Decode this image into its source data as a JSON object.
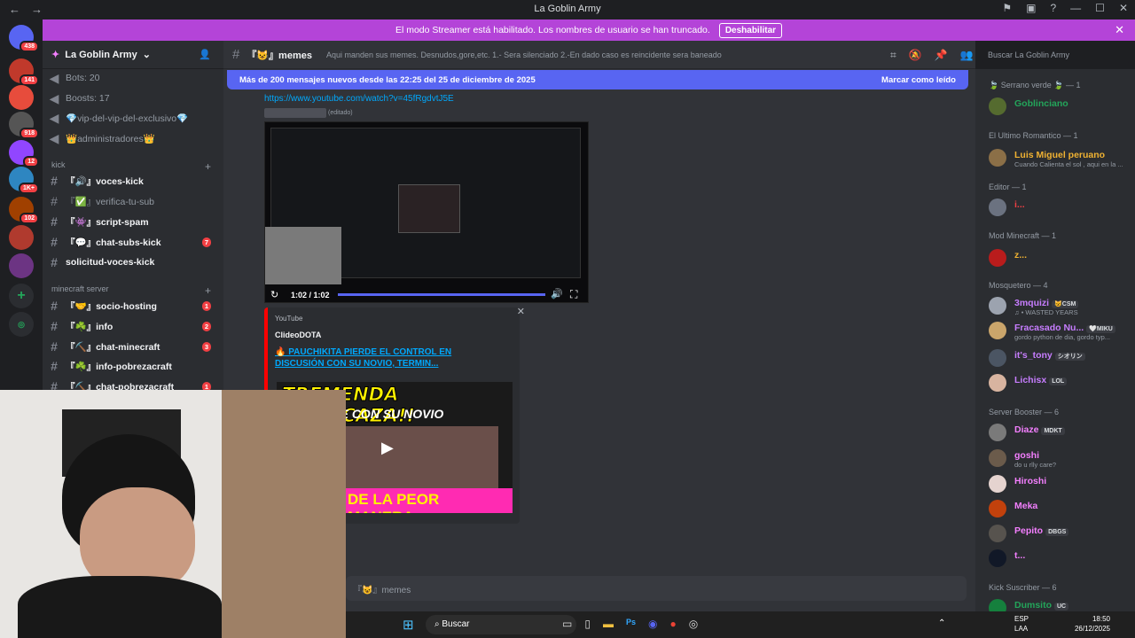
{
  "window": {
    "title": "La Goblin Army"
  },
  "banner": {
    "text": "El modo Streamer está habilitado. Los nombres de usuario se han truncado.",
    "button": "Deshabilitar"
  },
  "servers": [
    {
      "badge": "438"
    },
    {
      "badge": "141"
    },
    {
      "badge": ""
    },
    {
      "badge": "918"
    },
    {
      "badge": "12"
    },
    {
      "badge": "1K+"
    },
    {
      "badge": "102"
    },
    {
      "badge": ""
    },
    {
      "badge": ""
    }
  ],
  "server": {
    "name": "La Goblin Army"
  },
  "channels": {
    "top": [
      {
        "label": "Bots: 20"
      },
      {
        "label": "Boosts: 17"
      },
      {
        "label": "💎vip-del-vip-del-exclusivo💎"
      },
      {
        "label": "👑administradores👑"
      }
    ],
    "cat_kick": "kick",
    "kick": [
      {
        "label": "『🔊』voces-kick",
        "badge": ""
      },
      {
        "label": "『✅』verifica-tu-sub",
        "badge": ""
      },
      {
        "label": "『👾』script-spam",
        "badge": ""
      },
      {
        "label": "『💬』chat-subs-kick",
        "badge": "7"
      },
      {
        "label": "solicitud-voces-kick",
        "badge": ""
      }
    ],
    "cat_mc": "minecraft server",
    "mc": [
      {
        "label": "『🤝』socio-hosting",
        "badge": "1"
      },
      {
        "label": "『☘️』info",
        "badge": "2"
      },
      {
        "label": "『⛏️』chat-minecraft",
        "badge": "3"
      },
      {
        "label": "『☘️』info-pobrezacraft",
        "badge": ""
      },
      {
        "label": "『⛏️』chat-pobrezacraft",
        "badge": "1"
      }
    ]
  },
  "chat": {
    "channel": "『😺』memes",
    "topic": "Aqui manden sus memes. Desnudos,gore,etc. 1.- Sera silenciado 2.-En dado caso es reincidente sera baneado",
    "newbar": "Más de 200 mensajes nuevos desde las 22:25 del 25 de diciembre de 2025",
    "mark_read": "Marcar como leído",
    "link": "https://www.youtube.com/watch?v=45fRgdvtJ5E",
    "edited": "(editado)",
    "video_time": "1:02 / 1:02",
    "embed": {
      "provider": "YouTube",
      "author": "ClideoDOTA",
      "title": "🔥 PAUCHIKITA PIERDE EL CONTROL EN DISCUSIÓN CON SU NOVIO, TERMIN...",
      "thumb1": "TREMENDA BRONCAZA!!",
      "thumb2": "A DISCUTE CON SU NOVIO",
      "thumb3": "DE LA PEOR MANERA"
    },
    "input_placeholder": "『😺』memes",
    "search": "Buscar La Goblin Army"
  },
  "members": [
    {
      "cat": "🍃 Serrano verde 🍃 — 1",
      "users": [
        {
          "name": "Goblinciano",
          "status": "",
          "color": "#23a55a"
        }
      ]
    },
    {
      "cat": "El Ultimo Romantico — 1",
      "users": [
        {
          "name": "Luis Miguel peruano",
          "status": "Cuando Calienta el sol , aqui en la ...",
          "color": "#f0b232"
        }
      ]
    },
    {
      "cat": "Editor — 1",
      "users": [
        {
          "name": "i...",
          "status": "",
          "color": "#f23f43"
        }
      ]
    },
    {
      "cat": "Mod Minecraft — 1",
      "users": [
        {
          "name": "z...",
          "status": "",
          "color": "#f0b232"
        }
      ]
    },
    {
      "cat": "Mosquetero — 4",
      "users": [
        {
          "name": "3mquizi",
          "tag": "😺CSM",
          "status": "♫ • WASTED YEARS",
          "color": "#c77dff"
        },
        {
          "name": "Fracasado Nu...",
          "tag": "🤍MIKU",
          "status": "gordo python de dia, gordo typ...",
          "color": "#c77dff"
        },
        {
          "name": "it's_tony",
          "tag": "シオリン",
          "status": "",
          "color": "#c77dff"
        },
        {
          "name": "Lichisx",
          "tag": "LOL",
          "status": "",
          "color": "#c77dff"
        }
      ]
    },
    {
      "cat": "Server Booster — 6",
      "users": [
        {
          "name": "Diaze",
          "tag": "MDKT",
          "status": "",
          "color": "#f47fff"
        },
        {
          "name": "goshi",
          "tag": "",
          "status": "do u rlly care?",
          "color": "#f47fff"
        },
        {
          "name": "Hiroshi",
          "tag": "",
          "status": "",
          "color": "#f47fff"
        },
        {
          "name": "Meka",
          "tag": "",
          "status": "",
          "color": "#f47fff"
        },
        {
          "name": "Pepito",
          "tag": "DBGS",
          "status": "",
          "color": "#f47fff"
        },
        {
          "name": "t...",
          "tag": "",
          "status": "",
          "color": "#f47fff"
        }
      ]
    },
    {
      "cat": "Kick Suscriber — 6",
      "users": [
        {
          "name": "Dumsito",
          "tag": "UC",
          "status": "",
          "color": "#23a55a"
        }
      ]
    }
  ],
  "taskbar": {
    "search": "Buscar",
    "lang1": "ESP",
    "lang2": "LAA",
    "time": "18:50",
    "date": "26/12/2025"
  }
}
